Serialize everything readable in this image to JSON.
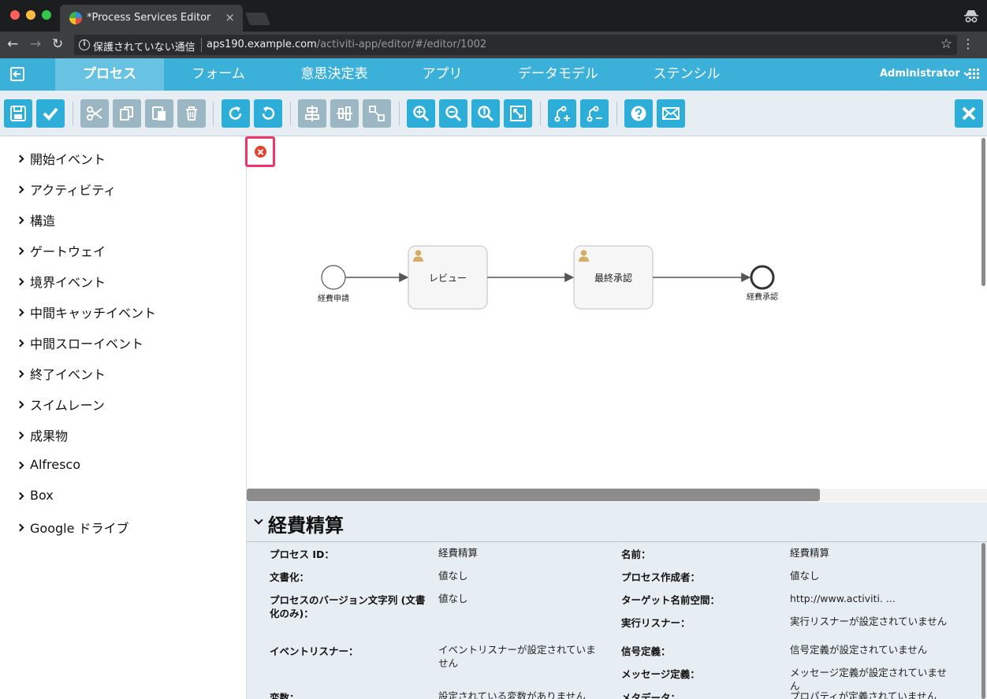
{
  "browser": {
    "tab_title": "*Process Services Editor",
    "tab_close": "×",
    "security_text": "保護されていない通信",
    "url_host": "aps190.example.com",
    "url_path": "/activiti-app/editor/#/editor/1002",
    "back": "←",
    "forward": "→",
    "reload": "↻",
    "star": "☆",
    "menu": "⋮"
  },
  "nav": {
    "items": [
      "プロセス",
      "フォーム",
      "意思決定表",
      "アプリ",
      "データモデル",
      "ステンシル"
    ],
    "active_index": 0,
    "user": "Administrator"
  },
  "palette": {
    "items": [
      "開始イベント",
      "アクティビティ",
      "構造",
      "ゲートウェイ",
      "境界イベント",
      "中間キャッチイベント",
      "中間スローイベント",
      "終了イベント",
      "スイムレーン",
      "成果物",
      "Alfresco",
      "Box",
      "Google ドライブ"
    ]
  },
  "diagram": {
    "start_label": "経費申請",
    "task1_label": "レビュー",
    "task2_label": "最終承認",
    "end_label": "経費承認"
  },
  "properties": {
    "title": "経費精算",
    "rows": [
      {
        "label": "プロセス ID：",
        "value": "経費精算"
      },
      {
        "label": "文書化：",
        "value": "値なし"
      },
      {
        "label": "プロセスのバージョン文字列 (文書化のみ)：",
        "value": "値なし"
      },
      {
        "label": "イベントリスナー：",
        "value": "イベントリスナーが設定されていません"
      },
      {
        "label": "変数：",
        "value": "設定されている変数がありません"
      },
      {
        "label": "名前：",
        "value": "経費精算"
      },
      {
        "label": "プロセス作成者：",
        "value": "値なし"
      },
      {
        "label": "ターゲット名前空間：",
        "value": "http://www.activiti. ..."
      },
      {
        "label": "実行リスナー：",
        "value": "実行リスナーが設定されていません"
      },
      {
        "label": "信号定義：",
        "value": "信号定義が設定されていません"
      },
      {
        "label": "メッセージ定義：",
        "value": "メッセージ定義が設定されていません"
      },
      {
        "label": "メタデータ：",
        "value": "プロパティが定義されていません"
      }
    ]
  },
  "colors": {
    "accent": "#3bb0d9",
    "toolbar_button": "#2caed8",
    "toolbar_disabled": "#9ab7c3",
    "highlight": "#f2346e"
  }
}
